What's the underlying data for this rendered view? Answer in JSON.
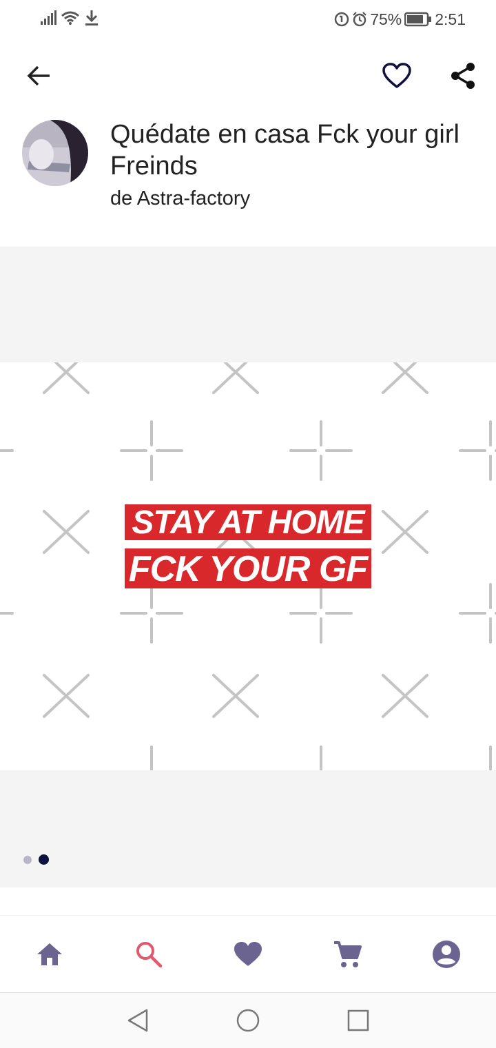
{
  "status_bar": {
    "battery": "75%",
    "time": "2:51"
  },
  "header": {
    "title": "Quédate en casa Fck your girl Freinds",
    "byline": "de Astra-factory"
  },
  "product": {
    "design_line_1": "STAY AT HOME",
    "design_line_2": "FCK YOUR GF",
    "design_color": "#d8282b"
  },
  "gallery": {
    "page_count": 2,
    "active_page": 2
  },
  "bottom_nav": {
    "items": [
      "home-icon",
      "search-icon",
      "heart-icon",
      "cart-icon",
      "account-icon"
    ],
    "accent": "#6b6390",
    "active_color": "#e0596d"
  }
}
